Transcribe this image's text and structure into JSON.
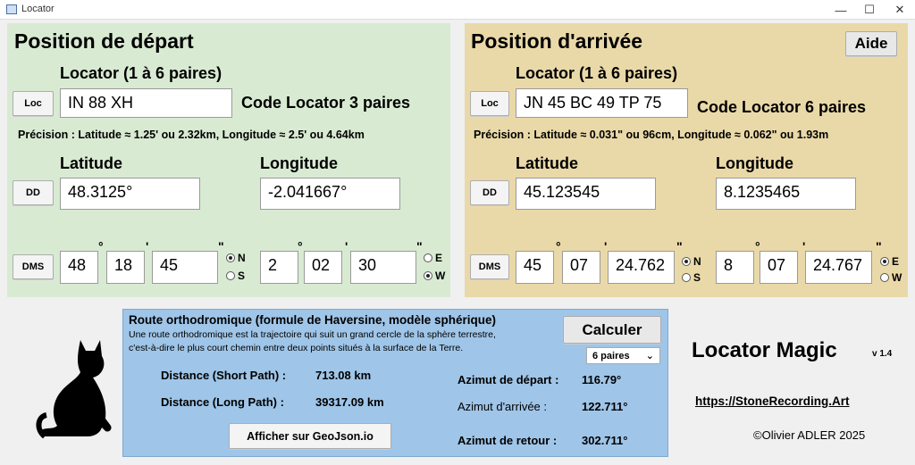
{
  "window": {
    "title": "Locator",
    "minimize": "—",
    "maximize": "☐",
    "close": "✕"
  },
  "depart": {
    "title": "Position de départ",
    "locator_label": "Locator (1 à 6 paires)",
    "loc_button": "Loc",
    "locator_value": "IN 88 XH",
    "code_text": "Code Locator 3 paires",
    "precision": "Précision : Latitude ≈ 1.25' ou 2.32km, Longitude ≈ 2.5' ou 4.64km",
    "lat_label": "Latitude",
    "lon_label": "Longitude",
    "dd_button": "DD",
    "lat_dd": "48.3125°",
    "lon_dd": "-2.041667°",
    "dms_button": "DMS",
    "lat_deg": "48",
    "lat_min": "18",
    "lat_sec": "45",
    "lon_deg": "2",
    "lon_min": "02",
    "lon_sec": "30",
    "ns": {
      "n": "N",
      "s": "S",
      "selected": "N"
    },
    "ew": {
      "e": "E",
      "w": "W",
      "selected": "W"
    }
  },
  "arrivee": {
    "title": "Position d'arrivée",
    "help_button": "Aide",
    "locator_label": "Locator (1 à 6 paires)",
    "loc_button": "Loc",
    "locator_value": "JN 45 BC 49 TP 75",
    "code_text": "Code Locator 6 paires",
    "precision": "Précision : Latitude ≈ 0.031\" ou 96cm, Longitude ≈ 0.062\" ou 1.93m",
    "lat_label": "Latitude",
    "lon_label": "Longitude",
    "dd_button": "DD",
    "lat_dd": "45.123545",
    "lon_dd": "8.1235465",
    "dms_button": "DMS",
    "lat_deg": "45",
    "lat_min": "07",
    "lat_sec": "24.762",
    "lon_deg": "8",
    "lon_min": "07",
    "lon_sec": "24.767",
    "ns": {
      "n": "N",
      "s": "S",
      "selected": "N"
    },
    "ew": {
      "e": "E",
      "w": "W",
      "selected": "E"
    }
  },
  "symbols": {
    "deg": "°",
    "min": "'",
    "sec": "\""
  },
  "route": {
    "title": "Route orthodromique (formule de Haversine, modèle sphérique)",
    "desc_line1": "Une route orthodromique est la trajectoire qui suit un grand cercle de la sphère terrestre,",
    "desc_line2": "c'est-à-dire le plus court chemin entre deux points situés à la surface de la Terre.",
    "calc_button": "Calculer",
    "pairs_select": "6 paires",
    "short_label": "Distance (Short Path) :",
    "short_value": "713.08 km",
    "long_label": "Distance (Long Path) :",
    "long_value": "39317.09 km",
    "az_dep_label": "Azimut de départ :",
    "az_dep_value": "116.79°",
    "az_arr_label": "Azimut d'arrivée :",
    "az_arr_value": "122.711°",
    "az_ret_label": "Azimut de retour :",
    "az_ret_value": "302.711°",
    "geojson_button": "Afficher sur GeoJson.io"
  },
  "brand": {
    "name": "Locator Magic",
    "version": "v 1.4",
    "url": "https://StoneRecording.Art",
    "copyright": "©Olivier ADLER 2025",
    "logo": "cat-silhouette"
  },
  "colors": {
    "depart_bg": "#d9ead3",
    "arrivee_bg": "#ead9a8",
    "route_bg": "#9fc5e8"
  }
}
